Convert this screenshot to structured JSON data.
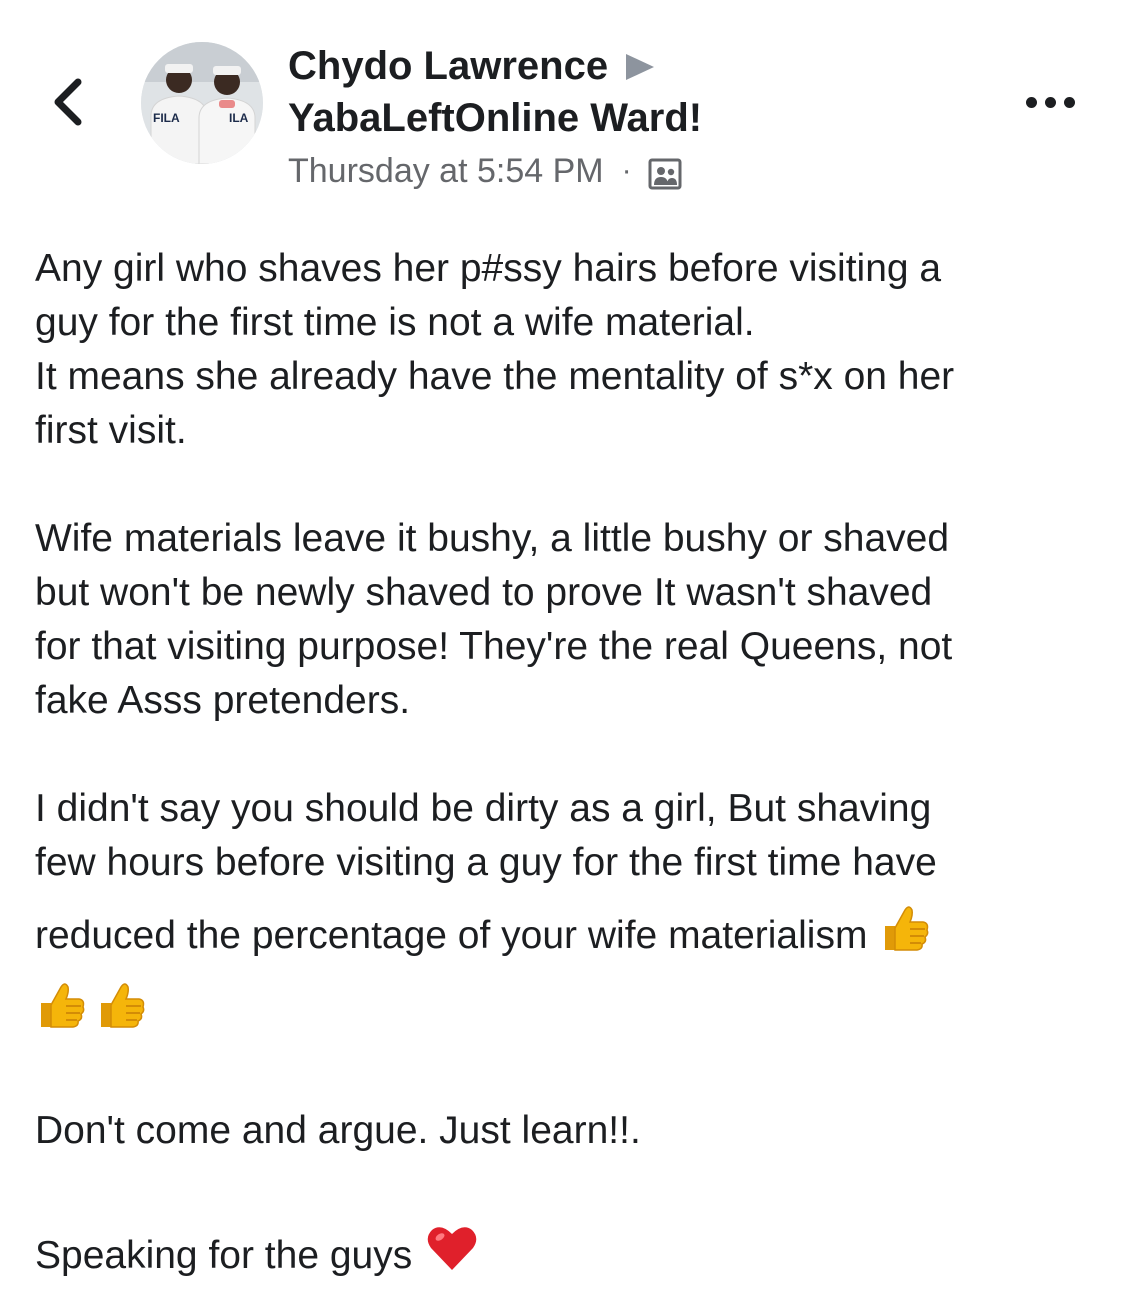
{
  "post": {
    "author": "Chydo Lawrence",
    "group": "YabaLeftOnline Ward!",
    "timestamp": "Thursday at 5:54 PM",
    "audience_icon": "group-members-icon",
    "avatar_text_left": "FILA",
    "avatar_text_right": "ILA"
  },
  "icons": {
    "back": "chevron-left-icon",
    "more": "more-options-icon",
    "arrow": "triangle-right-icon"
  },
  "body": {
    "p1_line1": "Any girl who shaves her p#ssy hairs before visiting a",
    "p1_line2": "guy for the first time is not a wife material.",
    "p1_line3": "It means she already have the mentality of s*x on her",
    "p1_line4": "first visit.",
    "p2_line1": "Wife materials leave it bushy, a little bushy or shaved",
    "p2_line2": "but won't be newly shaved to prove It wasn't shaved",
    "p2_line3": "for that visiting purpose! They're the real Queens, not",
    "p2_line4": "fake Asss pretenders.",
    "p3_line1": "I didn't say you should be dirty as a girl, But shaving",
    "p3_line2": "few hours before visiting a guy for the first time have",
    "p3_line3": "reduced the percentage of your wife materialism",
    "p4": "Don't come and argue. Just learn!!.",
    "p5": "Speaking for the guys"
  },
  "colors": {
    "text": "#1c1e21",
    "meta": "#65676b",
    "thumb": "#f5b50a",
    "heart": "#e0202b"
  }
}
